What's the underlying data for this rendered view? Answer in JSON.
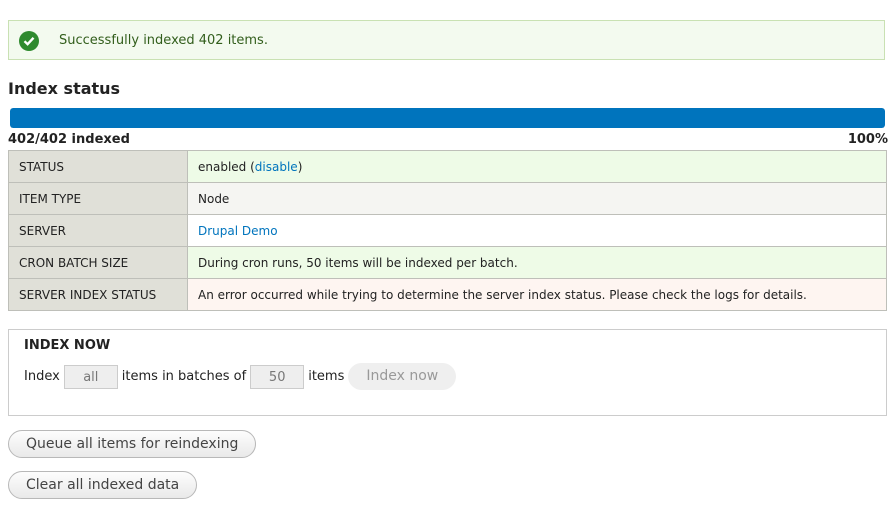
{
  "message": {
    "text": "Successfully indexed 402 items."
  },
  "index_status": {
    "heading": "Index status",
    "progress_label": "402/402 indexed",
    "progress_percent_text": "100%",
    "progress_fraction": 1.0
  },
  "status_table": {
    "status_key": "STATUS",
    "status_value": "enabled (",
    "status_link": "disable",
    "status_close": ")",
    "item_type_key": "ITEM TYPE",
    "item_type_value": "Node",
    "server_key": "SERVER",
    "server_value": "Drupal Demo",
    "cron_key": "CRON BATCH SIZE",
    "cron_value": "During cron runs, 50 items will be indexed per batch.",
    "server_index_key": "SERVER INDEX STATUS",
    "server_index_value": "An error occurred while trying to determine the server index status. Please check the logs for details."
  },
  "index_now": {
    "legend": "INDEX NOW",
    "prefix": "Index",
    "items_value": "all",
    "middle": "items in batches of",
    "batch_value": "50",
    "suffix": "items",
    "button": "Index now"
  },
  "actions": {
    "queue": "Queue all items for reindexing",
    "clear": "Clear all indexed data"
  },
  "colors": {
    "accent": "#0074bd",
    "success": "#2f8a2f",
    "error_bg": "#fef5f1"
  }
}
